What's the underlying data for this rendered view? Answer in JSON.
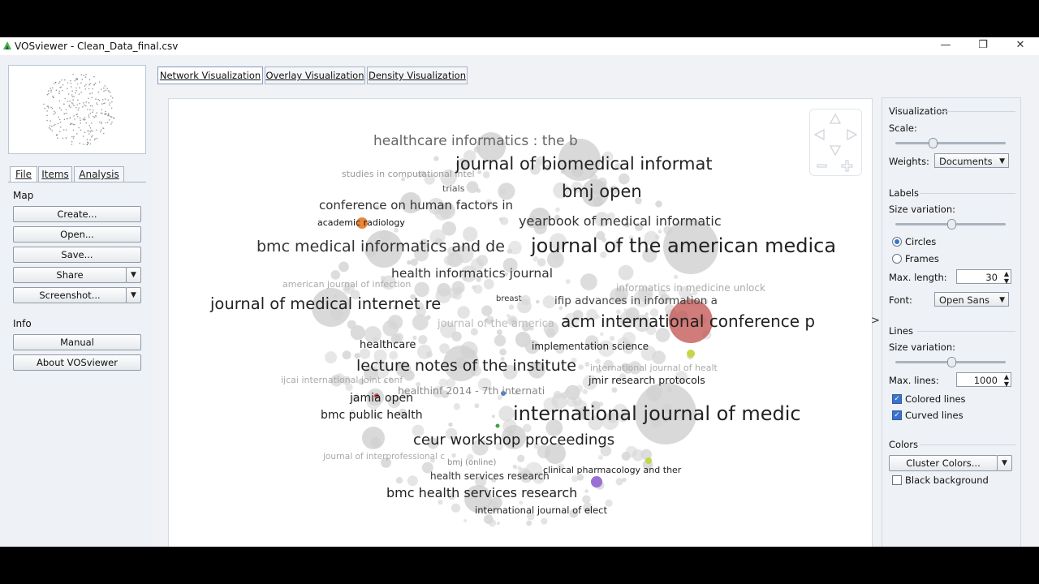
{
  "window": {
    "title": "VOSviewer - Clean_Data_final.csv",
    "minimize_glyph": "—",
    "restore_glyph": "❐",
    "close_glyph": "✕"
  },
  "left_panel": {
    "tabs": [
      "File",
      "Items",
      "Analysis"
    ],
    "map_header": "Map",
    "map_buttons": [
      "Create...",
      "Open...",
      "Save...",
      "Share",
      "Screenshot..."
    ],
    "info_header": "Info",
    "info_buttons": [
      "Manual",
      "About VOSviewer"
    ]
  },
  "tabs": [
    "Network Visualization",
    "Overlay Visualization",
    "Density Visualization"
  ],
  "network": {
    "labels": [
      "healthcare informatics : the b",
      "journal of biomedical informat",
      "bmj open",
      "conference on human factors in",
      "yearbook of medical informatic",
      "bmc medical informatics and de",
      "journal of the american medica",
      "health informatics journal",
      "journal of medical internet re",
      "acm international conference p",
      "ifip advances in information a",
      "informatics in medicine unlock",
      "lecture notes of the institute",
      "implementation science",
      "healthcare",
      "jmir research protocols",
      "jamia open",
      "bmc public health",
      "healthinf 2014 - 7th internati",
      "international journal of medic",
      "ceur workshop proceedings",
      "health services research",
      "clinical pharmacology and ther",
      "bmc health services research",
      "international journal of elect",
      "academic radiology",
      "studies in computational intel",
      "trials",
      "american journal of infection",
      "breast",
      "journal of the america",
      "international journal of healt",
      "ijcai international joint conf",
      "bmj (online)",
      "journal of interprofessional c"
    ]
  },
  "settings": {
    "visualization_header": "Visualization",
    "scale_label": "Scale:",
    "scale_value": 0.32,
    "weights_label": "Weights:",
    "weights_value": "Documents",
    "labels_header": "Labels",
    "label_size_variation_label": "Size variation:",
    "label_size_variation_value": 0.5,
    "circles_label": "Circles",
    "frames_label": "Frames",
    "max_length_label": "Max. length:",
    "max_length_value": "30",
    "font_label": "Font:",
    "font_value": "Open Sans",
    "lines_header": "Lines",
    "line_size_variation_label": "Size variation:",
    "line_size_variation_value": 0.5,
    "max_lines_label": "Max. lines:",
    "max_lines_value": "1000",
    "colored_lines_label": "Colored lines",
    "curved_lines_label": "Curved lines",
    "colors_header": "Colors",
    "cluster_colors_label": "Cluster Colors...",
    "black_background_label": "Black background"
  },
  "icons": {
    "app": "vosviewer-logo-icon",
    "collapse": "chevron-right-icon",
    "nav_up": "triangle-up-icon",
    "nav_down": "triangle-down-icon",
    "nav_left": "triangle-left-icon",
    "nav_right": "triangle-right-icon",
    "zoom_out": "minus-icon",
    "zoom_in": "plus-icon"
  },
  "colors": {
    "cluster_red": "#c0504d",
    "cluster_orange": "#e7873a",
    "cluster_yellow_green": "#c5d646",
    "cluster_purple": "#9b6fd4",
    "cluster_blue": "#4f7fc9",
    "cluster_green": "#43a047",
    "node_grey": "#cfcfcf"
  }
}
